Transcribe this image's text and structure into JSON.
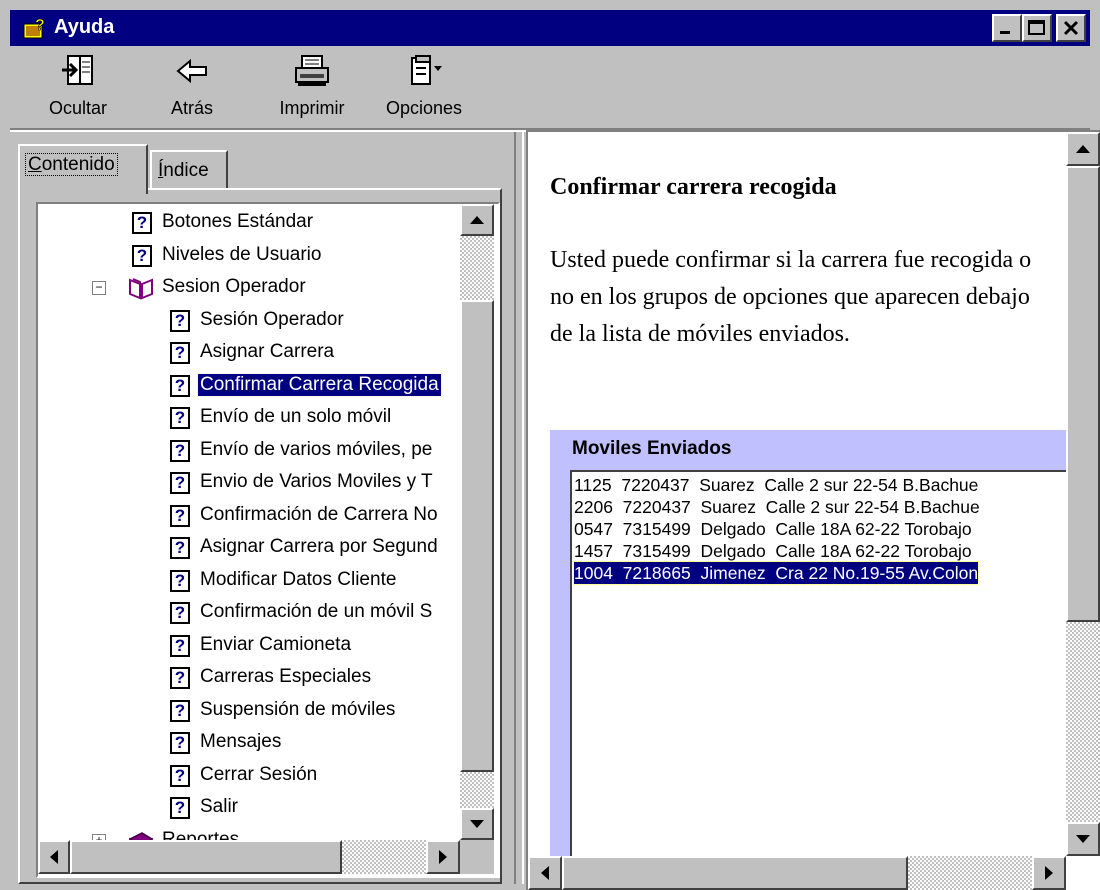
{
  "window": {
    "title": "Ayuda"
  },
  "toolbar": {
    "ocultar": "Ocultar",
    "atras": "Atrás",
    "imprimir": "Imprimir",
    "opciones": "Opciones"
  },
  "tabs": {
    "contenido": {
      "pre": "",
      "accel": "C",
      "post": "ontenido"
    },
    "indice": {
      "pre": "",
      "accel": "Í",
      "post": "ndice"
    }
  },
  "tree": {
    "items": [
      {
        "label": "Botones Estándar",
        "type": "topic"
      },
      {
        "label": "Niveles de Usuario",
        "type": "topic"
      },
      {
        "label": "Sesion Operador",
        "type": "book-open"
      },
      {
        "label": "Sesión Operador",
        "type": "topic"
      },
      {
        "label": "Asignar Carrera",
        "type": "topic"
      },
      {
        "label": "Confirmar Carrera Recogida",
        "type": "topic",
        "selected": true
      },
      {
        "label": "Envío de un solo móvil",
        "type": "topic"
      },
      {
        "label": "Envío de varios móviles, pe",
        "type": "topic"
      },
      {
        "label": "Envio de Varios Moviles y T",
        "type": "topic"
      },
      {
        "label": "Confirmación de Carrera No",
        "type": "topic"
      },
      {
        "label": "Asignar Carrera por Segund",
        "type": "topic"
      },
      {
        "label": "Modificar Datos Cliente",
        "type": "topic"
      },
      {
        "label": "Confirmación de un móvil S",
        "type": "topic"
      },
      {
        "label": "Enviar Camioneta",
        "type": "topic"
      },
      {
        "label": "Carreras Especiales",
        "type": "topic"
      },
      {
        "label": "Suspensión de móviles",
        "type": "topic"
      },
      {
        "label": "Mensajes",
        "type": "topic"
      },
      {
        "label": "Cerrar Sesión",
        "type": "topic"
      },
      {
        "label": "Salir",
        "type": "topic"
      },
      {
        "label": "Reportes",
        "type": "book-closed"
      }
    ]
  },
  "content": {
    "title": "Confirmar carrera recogida",
    "paragraph": "Usted puede confirmar si la carrera fue recogida o no en los grupos de opciones que aparecen debajo de la lista de móviles enviados.",
    "moviles": {
      "title": "Moviles Enviados",
      "rows": [
        {
          "text": "1125  7220437  Suarez  Calle 2 sur 22-54 B.Bachue"
        },
        {
          "text": "2206  7220437  Suarez  Calle 2 sur 22-54 B.Bachue"
        },
        {
          "text": "0547  7315499  Delgado  Calle 18A 62-22 Torobajo"
        },
        {
          "text": "1457  7315499  Delgado  Calle 18A 62-22 Torobajo"
        },
        {
          "text": "1004  7218665  Jimenez  Cra 22 No.19-55 Av.Colon",
          "selected": true
        }
      ]
    }
  },
  "colors": {
    "titlebar": "#000080",
    "selection": "#000080",
    "frame": "#c0c0ff",
    "face": "#c0c0c0"
  }
}
